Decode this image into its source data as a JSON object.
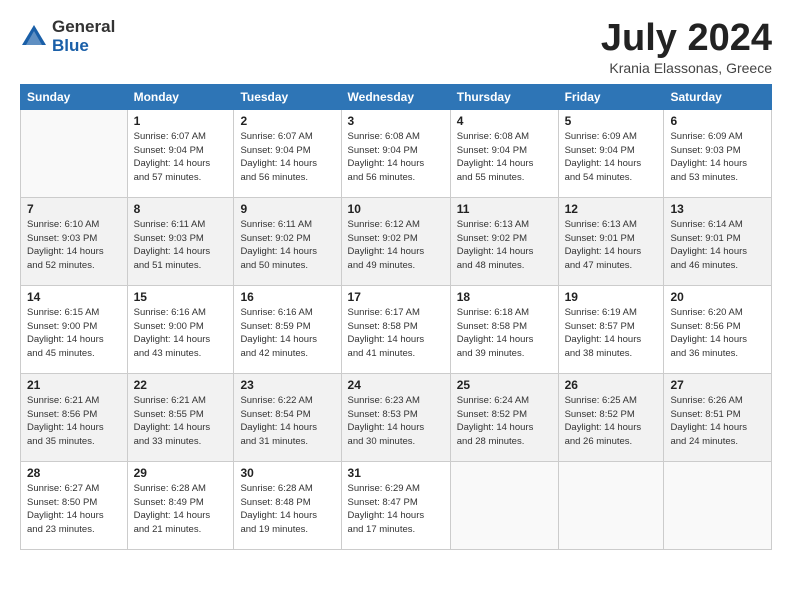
{
  "logo": {
    "general": "General",
    "blue": "Blue"
  },
  "header": {
    "month": "July 2024",
    "location": "Krania Elassonas, Greece"
  },
  "weekdays": [
    "Sunday",
    "Monday",
    "Tuesday",
    "Wednesday",
    "Thursday",
    "Friday",
    "Saturday"
  ],
  "weeks": [
    [
      {
        "day": "",
        "info": ""
      },
      {
        "day": "1",
        "info": "Sunrise: 6:07 AM\nSunset: 9:04 PM\nDaylight: 14 hours\nand 57 minutes."
      },
      {
        "day": "2",
        "info": "Sunrise: 6:07 AM\nSunset: 9:04 PM\nDaylight: 14 hours\nand 56 minutes."
      },
      {
        "day": "3",
        "info": "Sunrise: 6:08 AM\nSunset: 9:04 PM\nDaylight: 14 hours\nand 56 minutes."
      },
      {
        "day": "4",
        "info": "Sunrise: 6:08 AM\nSunset: 9:04 PM\nDaylight: 14 hours\nand 55 minutes."
      },
      {
        "day": "5",
        "info": "Sunrise: 6:09 AM\nSunset: 9:04 PM\nDaylight: 14 hours\nand 54 minutes."
      },
      {
        "day": "6",
        "info": "Sunrise: 6:09 AM\nSunset: 9:03 PM\nDaylight: 14 hours\nand 53 minutes."
      }
    ],
    [
      {
        "day": "7",
        "info": "Sunrise: 6:10 AM\nSunset: 9:03 PM\nDaylight: 14 hours\nand 52 minutes."
      },
      {
        "day": "8",
        "info": "Sunrise: 6:11 AM\nSunset: 9:03 PM\nDaylight: 14 hours\nand 51 minutes."
      },
      {
        "day": "9",
        "info": "Sunrise: 6:11 AM\nSunset: 9:02 PM\nDaylight: 14 hours\nand 50 minutes."
      },
      {
        "day": "10",
        "info": "Sunrise: 6:12 AM\nSunset: 9:02 PM\nDaylight: 14 hours\nand 49 minutes."
      },
      {
        "day": "11",
        "info": "Sunrise: 6:13 AM\nSunset: 9:02 PM\nDaylight: 14 hours\nand 48 minutes."
      },
      {
        "day": "12",
        "info": "Sunrise: 6:13 AM\nSunset: 9:01 PM\nDaylight: 14 hours\nand 47 minutes."
      },
      {
        "day": "13",
        "info": "Sunrise: 6:14 AM\nSunset: 9:01 PM\nDaylight: 14 hours\nand 46 minutes."
      }
    ],
    [
      {
        "day": "14",
        "info": "Sunrise: 6:15 AM\nSunset: 9:00 PM\nDaylight: 14 hours\nand 45 minutes."
      },
      {
        "day": "15",
        "info": "Sunrise: 6:16 AM\nSunset: 9:00 PM\nDaylight: 14 hours\nand 43 minutes."
      },
      {
        "day": "16",
        "info": "Sunrise: 6:16 AM\nSunset: 8:59 PM\nDaylight: 14 hours\nand 42 minutes."
      },
      {
        "day": "17",
        "info": "Sunrise: 6:17 AM\nSunset: 8:58 PM\nDaylight: 14 hours\nand 41 minutes."
      },
      {
        "day": "18",
        "info": "Sunrise: 6:18 AM\nSunset: 8:58 PM\nDaylight: 14 hours\nand 39 minutes."
      },
      {
        "day": "19",
        "info": "Sunrise: 6:19 AM\nSunset: 8:57 PM\nDaylight: 14 hours\nand 38 minutes."
      },
      {
        "day": "20",
        "info": "Sunrise: 6:20 AM\nSunset: 8:56 PM\nDaylight: 14 hours\nand 36 minutes."
      }
    ],
    [
      {
        "day": "21",
        "info": "Sunrise: 6:21 AM\nSunset: 8:56 PM\nDaylight: 14 hours\nand 35 minutes."
      },
      {
        "day": "22",
        "info": "Sunrise: 6:21 AM\nSunset: 8:55 PM\nDaylight: 14 hours\nand 33 minutes."
      },
      {
        "day": "23",
        "info": "Sunrise: 6:22 AM\nSunset: 8:54 PM\nDaylight: 14 hours\nand 31 minutes."
      },
      {
        "day": "24",
        "info": "Sunrise: 6:23 AM\nSunset: 8:53 PM\nDaylight: 14 hours\nand 30 minutes."
      },
      {
        "day": "25",
        "info": "Sunrise: 6:24 AM\nSunset: 8:52 PM\nDaylight: 14 hours\nand 28 minutes."
      },
      {
        "day": "26",
        "info": "Sunrise: 6:25 AM\nSunset: 8:52 PM\nDaylight: 14 hours\nand 26 minutes."
      },
      {
        "day": "27",
        "info": "Sunrise: 6:26 AM\nSunset: 8:51 PM\nDaylight: 14 hours\nand 24 minutes."
      }
    ],
    [
      {
        "day": "28",
        "info": "Sunrise: 6:27 AM\nSunset: 8:50 PM\nDaylight: 14 hours\nand 23 minutes."
      },
      {
        "day": "29",
        "info": "Sunrise: 6:28 AM\nSunset: 8:49 PM\nDaylight: 14 hours\nand 21 minutes."
      },
      {
        "day": "30",
        "info": "Sunrise: 6:28 AM\nSunset: 8:48 PM\nDaylight: 14 hours\nand 19 minutes."
      },
      {
        "day": "31",
        "info": "Sunrise: 6:29 AM\nSunset: 8:47 PM\nDaylight: 14 hours\nand 17 minutes."
      },
      {
        "day": "",
        "info": ""
      },
      {
        "day": "",
        "info": ""
      },
      {
        "day": "",
        "info": ""
      }
    ]
  ]
}
